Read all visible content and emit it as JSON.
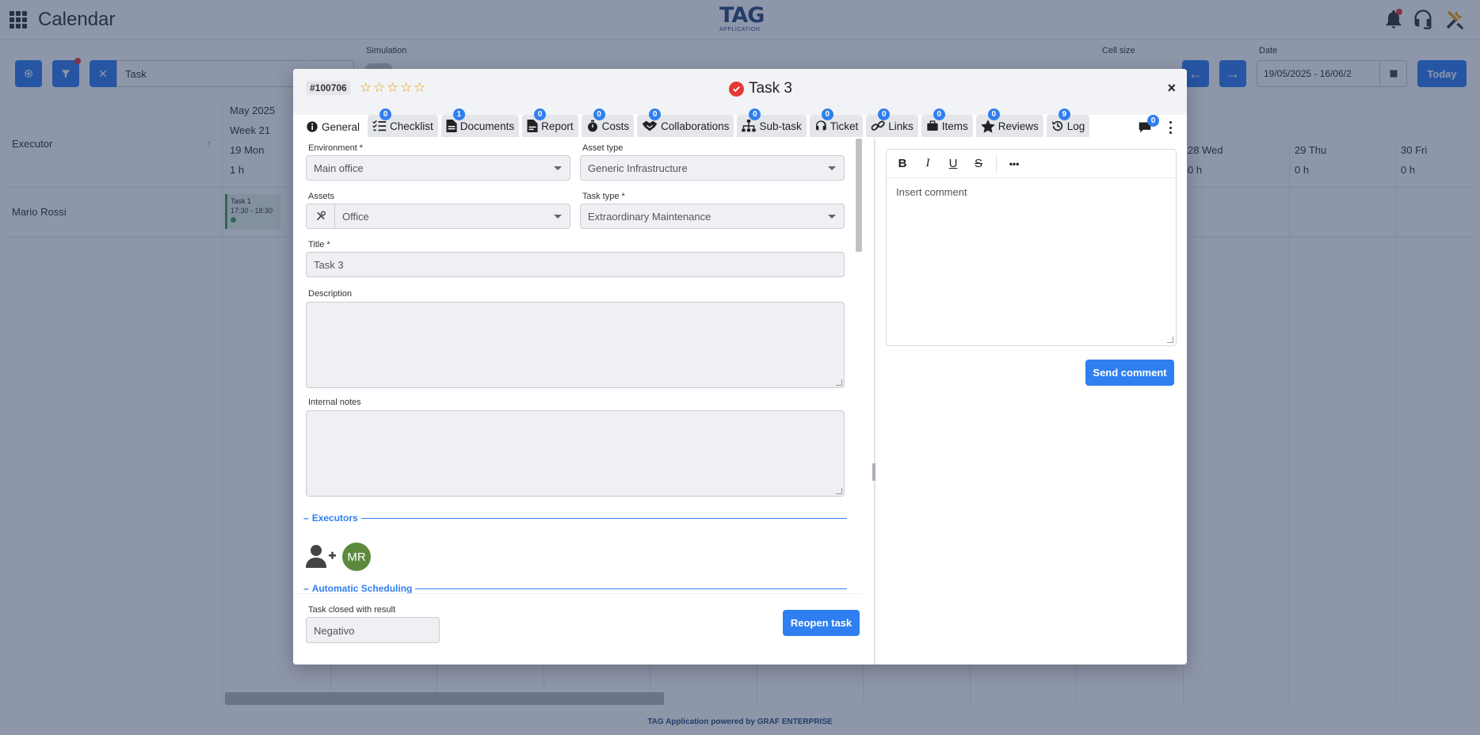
{
  "app": {
    "title": "Calendar",
    "logo_main": "TAG",
    "logo_sub": "APPLICATION",
    "footer": "TAG Application powered by GRAF ENTERPRISE"
  },
  "toolbar": {
    "search_value": "Task",
    "simulation_label": "Simulation",
    "cell_size_label": "Cell size",
    "date_label": "Date",
    "date_value": "19/05/2025 - 16/06/2",
    "today_label": "Today"
  },
  "calendar": {
    "executor_header": "Executor",
    "month": "May 2025",
    "week": "Week 21",
    "day_first": "19 Mon",
    "hours_first": "1 h",
    "day_28": "28 Wed",
    "day_29": "29 Thu",
    "day_30": "30 Fri",
    "hours_zero": "0 h",
    "executor_name": "Mario Rossi",
    "task_chip_title": "Task 1",
    "task_chip_time": "17:30 - 18:30"
  },
  "modal": {
    "task_id": "#100706",
    "rating": 0,
    "stars_max": 5,
    "title": "Task 3",
    "close_label": "×",
    "tabs": [
      {
        "label": "General",
        "badge": ""
      },
      {
        "label": "Checklist",
        "badge": "0"
      },
      {
        "label": "Documents",
        "badge": "1"
      },
      {
        "label": "Report",
        "badge": "0"
      },
      {
        "label": "Costs",
        "badge": "0"
      },
      {
        "label": "Collaborations",
        "badge": "0"
      },
      {
        "label": "Sub-task",
        "badge": "0"
      },
      {
        "label": "Ticket",
        "badge": "0"
      },
      {
        "label": "Links",
        "badge": "0"
      },
      {
        "label": "Items",
        "badge": "0"
      },
      {
        "label": "Reviews",
        "badge": "0"
      },
      {
        "label": "Log",
        "badge": "9"
      }
    ],
    "chat_badge": "0",
    "form": {
      "environment_label": "Environment *",
      "environment_value": "Main office",
      "asset_type_label": "Asset type",
      "asset_type_value": "Generic Infrastructure",
      "assets_label": "Assets",
      "assets_value": "Office",
      "task_type_label": "Task type *",
      "task_type_value": "Extraordinary Maintenance",
      "title_label": "Title *",
      "title_value": "Task 3",
      "description_label": "Description",
      "internal_notes_label": "Internal notes",
      "executors_section": "Executors",
      "executor_initials": "MR",
      "scheduling_section": "Automatic Scheduling",
      "closed_label": "Task closed with result",
      "closed_value": "Negativo",
      "reopen_label": "Reopen task"
    },
    "comment": {
      "toolbar": [
        "B",
        "I",
        "U",
        "S",
        "•••"
      ],
      "placeholder": "Insert comment",
      "send_label": "Send comment"
    }
  },
  "colors": {
    "accent": "#2f7ff0",
    "status_closed": "#e53935",
    "avatar": "#5b8a3c",
    "star": "#e0a000"
  }
}
